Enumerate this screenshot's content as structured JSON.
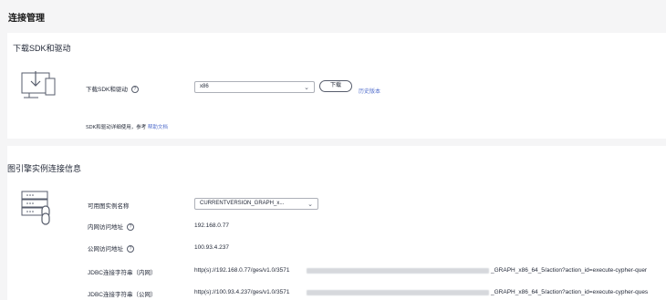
{
  "page": {
    "title": "连接管理"
  },
  "sdk_section": {
    "title": "下载SDK和驱动",
    "icon": "download-monitor-icon",
    "field_label": "下载SDK和驱动",
    "help_icon": "question-circle-icon",
    "select_value": "x86",
    "download_button": "下载",
    "history_link": "历史版本",
    "note": "SDK和驱动详细使用，参考",
    "help_doc_link": "帮助文档"
  },
  "connection_section": {
    "title": "图引擎实例连接信息",
    "icon": "server-link-icon",
    "instance_label": "可用图实例名称",
    "instance_value": "CURRENTVERSION_GRAPH_x...",
    "rows": [
      {
        "label": "内网访问地址",
        "value": "192.168.0.77"
      },
      {
        "label": "公网访问地址",
        "value": "100.93.4.237"
      }
    ],
    "jdbc_rows": [
      {
        "label": "JDBC连接字符串（内网）",
        "prefix": "http(s)://192.168.0.77/ges/v1.0/3571",
        "suffix": "_GRAPH_x86_64_5/action?action_id=execute-cypher-quer"
      },
      {
        "label": "JDBC连接字符串（公网）",
        "prefix": "http(s)://100.93.4.237/ges/v1.0/3571",
        "suffix": "_GRAPH_x86_64_5/action?action_id=execute-cypher-ques"
      }
    ]
  },
  "colors": {
    "link": "#526ecc",
    "background": "#f5f5f6",
    "card": "#ffffff",
    "text": "#252b3a"
  }
}
